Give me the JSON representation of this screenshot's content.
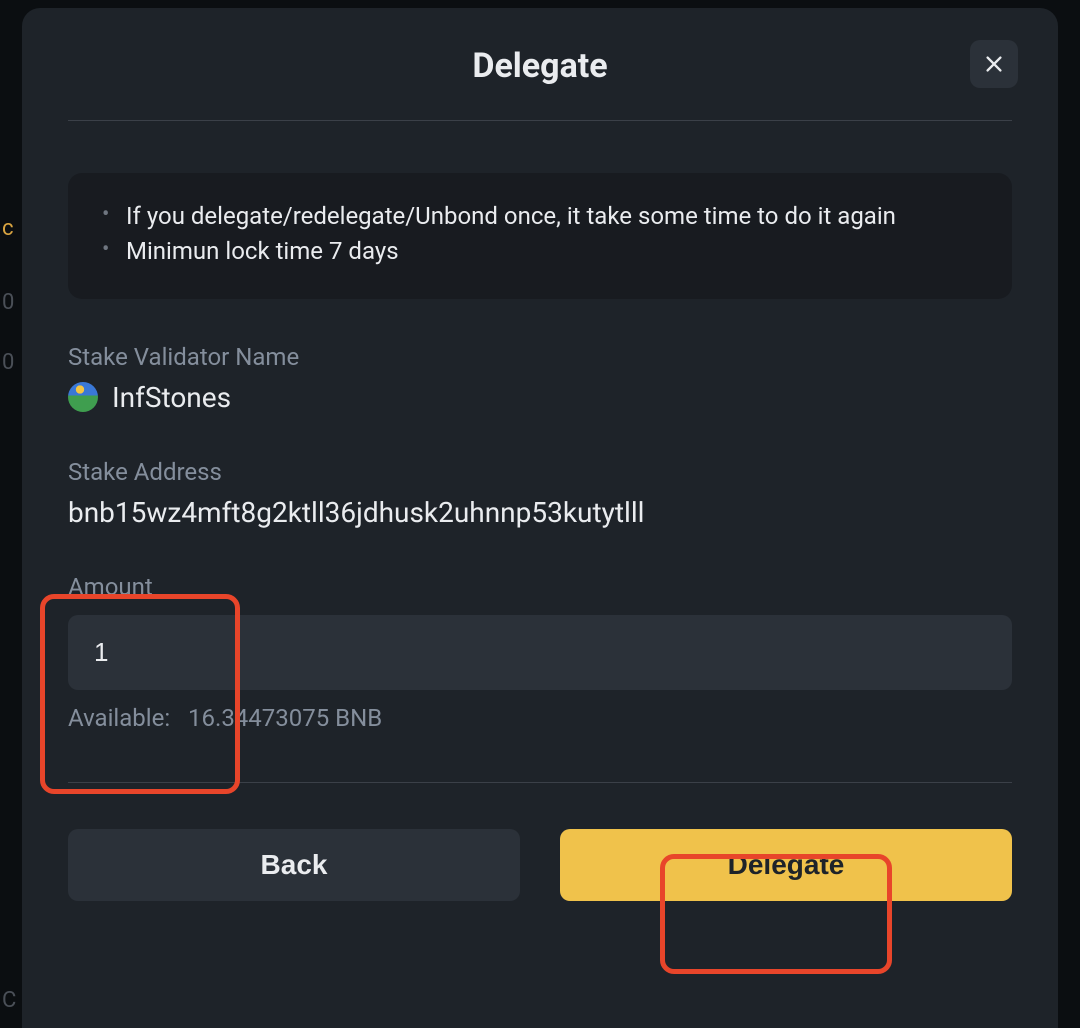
{
  "modal": {
    "title": "Delegate",
    "info_items": [
      "If you delegate/redelegate/Unbond once, it take some time to do it again",
      "Minimun lock time 7 days"
    ],
    "validator": {
      "label": "Stake Validator Name",
      "name": "InfStones"
    },
    "address": {
      "label": "Stake Address",
      "value": "bnb15wz4mft8g2ktll36jdhusk2uhnnp53kutytlll"
    },
    "amount": {
      "label": "Amount",
      "value": "1",
      "available_label": "Available:",
      "available_value": "16.34473075 BNB"
    },
    "buttons": {
      "back": "Back",
      "delegate": "Delegate"
    }
  },
  "bg_hints": {
    "h1": "c",
    "h2": "0",
    "h3": "0",
    "h4": "C"
  }
}
